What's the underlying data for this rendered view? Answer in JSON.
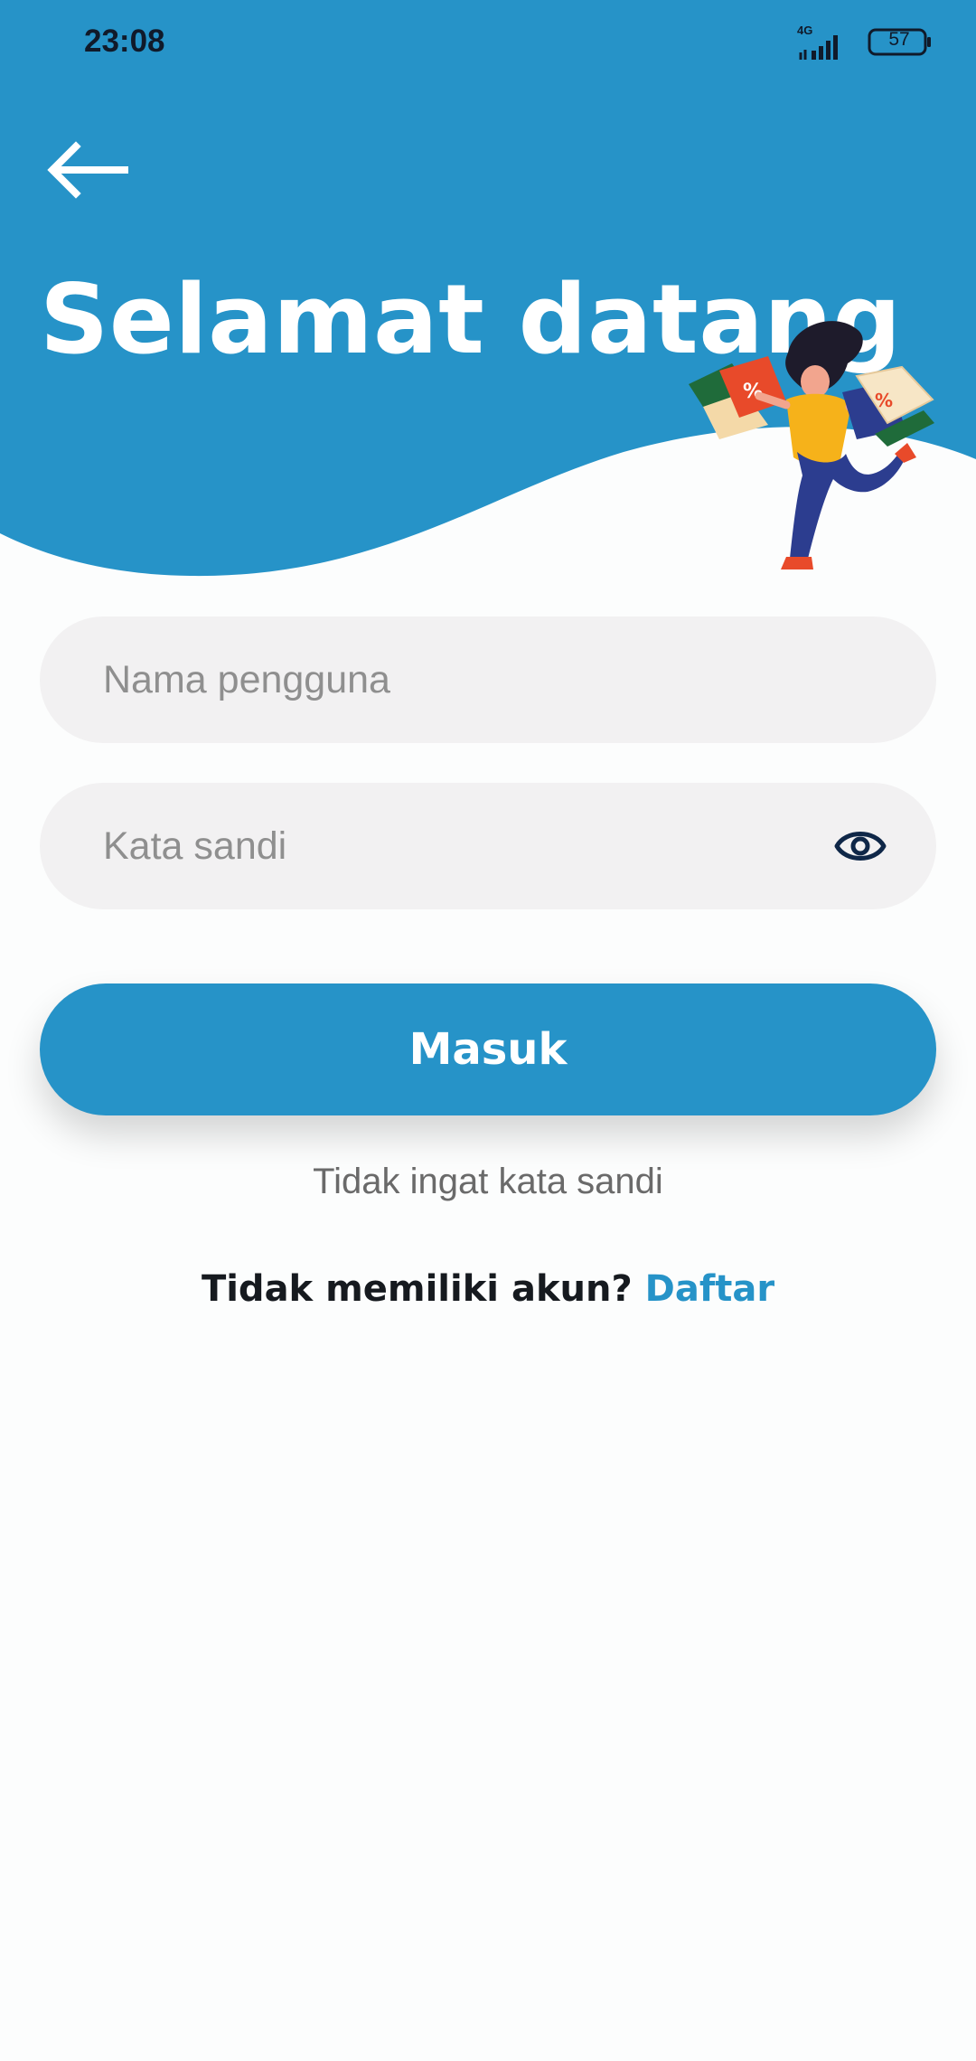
{
  "status_bar": {
    "time": "23:08",
    "network": "4G",
    "battery_level": "57"
  },
  "header": {
    "title": "Selamat datang",
    "background_color": "#2693c8",
    "back_icon": "arrow-left-icon"
  },
  "form": {
    "username_placeholder": "Nama pengguna",
    "password_placeholder": "Kata sandi",
    "password_toggle_icon": "eye-icon"
  },
  "actions": {
    "login_label": "Masuk",
    "forgot_password_label": "Tidak ingat kata sandi",
    "signup_prompt": "Tidak memiliki akun?",
    "signup_link": "Daftar"
  },
  "colors": {
    "primary": "#2693c8",
    "input_bg": "#f2f1f2",
    "placeholder": "#8f8f8f",
    "icon_dark": "#0f2748"
  }
}
